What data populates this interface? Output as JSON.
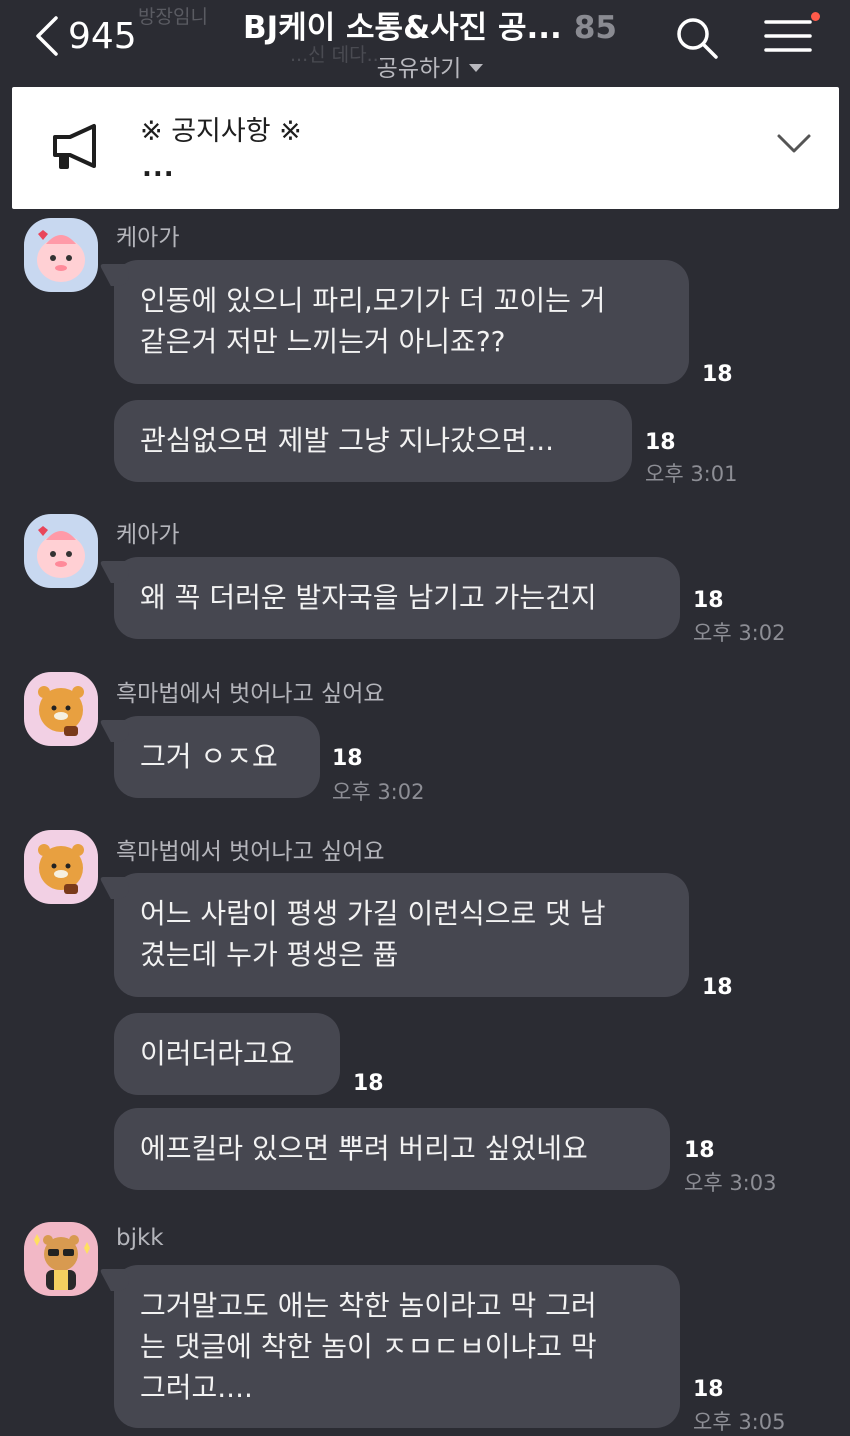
{
  "header": {
    "back_count": "945",
    "title": "BJ케이 소통&사진 공...",
    "member_count": "85",
    "share_label": "공유하기",
    "ghost_text": "방장임니",
    "ghost_text2": "...신 데다..."
  },
  "notice": {
    "title": "※ 공지사항 ※",
    "preview": "..."
  },
  "messages": [
    {
      "sender": "케아가",
      "text_lines": [
        "인동에 있으니 파리,모기가 더 꼬이는 거",
        "같은거 저만 느끼는거 아니죠??"
      ],
      "unread": "18",
      "time": ""
    },
    {
      "sender": "",
      "text_lines": [
        "관심없으면 제발 그냥 지나갔으면..."
      ],
      "unread": "18",
      "time": "오후 3:01"
    },
    {
      "sender": "케아가",
      "text_lines": [
        "왜 꼭 더러운 발자국을 남기고 가는건지"
      ],
      "unread": "18",
      "time": "오후 3:02"
    },
    {
      "sender": "흑마법에서 벗어나고 싶어요",
      "text_lines": [
        "그거 ㅇㅈ요"
      ],
      "unread": "18",
      "time": "오후 3:02"
    },
    {
      "sender": "흑마법에서 벗어나고 싶어요",
      "text_lines": [
        "어느 사람이 평생 가길 이런식으로 댓 남",
        "겼는데  누가 평생은 퓹"
      ],
      "unread": "18",
      "time": ""
    },
    {
      "sender": "",
      "text_lines": [
        "이러더라고요"
      ],
      "unread": "18",
      "time": ""
    },
    {
      "sender": "",
      "text_lines": [
        "에프킬라 있으면 뿌려 버리고 싶었네요"
      ],
      "unread": "18",
      "time": "오후 3:03"
    },
    {
      "sender": "bjkk",
      "text_lines": [
        "그거말고도 애는 착한 놈이라고 막 그러",
        "는 댓글에 착한 놈이 ㅈㅁㄷㅂ이냐고 막",
        "그러고...."
      ],
      "unread": "18",
      "time": "오후 3:05"
    }
  ],
  "icons": {
    "back": "chevron-left-icon",
    "search": "search-icon",
    "menu": "hamburger-menu-icon",
    "notice": "megaphone-icon",
    "expand": "chevron-down-icon"
  },
  "colors": {
    "background": "#2b2c33",
    "bubble": "#464750",
    "notice_bg": "#ffffff",
    "badge_dot": "#ff5a4a"
  }
}
